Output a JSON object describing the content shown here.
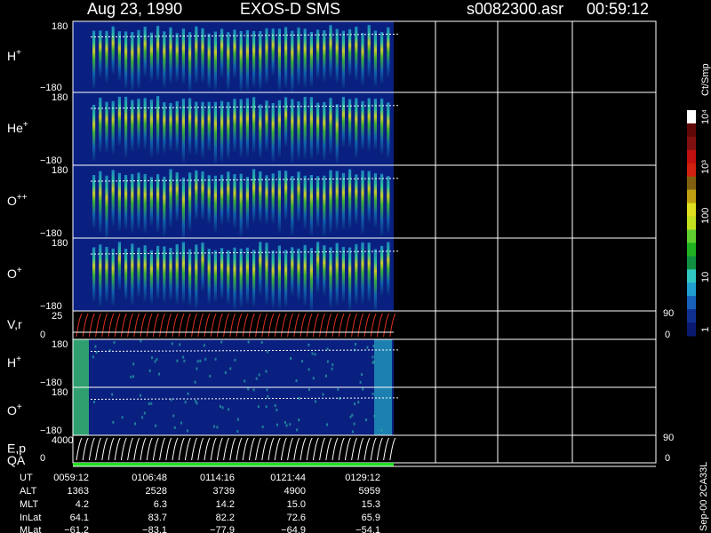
{
  "header": {
    "date": "Aug 23, 1990",
    "instrument": "EXOS-D SMS",
    "file": "s0082300.asr",
    "time": "00:59:12"
  },
  "chart_data": {
    "type": "heatmap",
    "description_panels": [
      {
        "label": "H",
        "sup": "+",
        "ymax": "180",
        "ymin": "−180"
      },
      {
        "label": "He",
        "sup": "+",
        "ymax": "180",
        "ymin": "−180"
      },
      {
        "label": "O",
        "sup": "++",
        "ymax": "180",
        "ymin": "−180"
      },
      {
        "label": "O",
        "sup": "+",
        "ymax": "180",
        "ymin": "−180"
      },
      {
        "label": "V",
        "sup": "",
        "sub": ",r",
        "ymax": "25",
        "ymin": "0",
        "rmax": "90",
        "rmin": "0"
      },
      {
        "label": "H",
        "sup": "+",
        "ymax": "180",
        "ymin": "−180"
      },
      {
        "label": "O",
        "sup": "+",
        "ymax": "180",
        "ymin": "−180"
      },
      {
        "label": "E,p",
        "ymax": "4000",
        "ymin": "0",
        "rmax": "90",
        "rmin": "0"
      }
    ],
    "qa_label": "QA",
    "colorbar": {
      "unit": "Ct/Smp",
      "ticks": [
        "10⁴",
        "10³",
        "100",
        "10",
        "1"
      ]
    },
    "ephemeris": {
      "labels": [
        "UT",
        "ALT",
        "MLT",
        "InLat",
        "MLat"
      ],
      "columns": [
        [
          "0059:12",
          "1363",
          "4.2",
          "64.1",
          "−61.2"
        ],
        [
          "0106:48",
          "2528",
          "6.3",
          "83.7",
          "−83.1"
        ],
        [
          "0114:16",
          "3739",
          "14.2",
          "82.2",
          "−77.9"
        ],
        [
          "0121:44",
          "4900",
          "15.0",
          "72.6",
          "−64.9"
        ],
        [
          "0129:12",
          "5959",
          "15.3",
          "65.9",
          "−54.1"
        ]
      ]
    },
    "footer_code": "Sep-00 2CA33L"
  }
}
